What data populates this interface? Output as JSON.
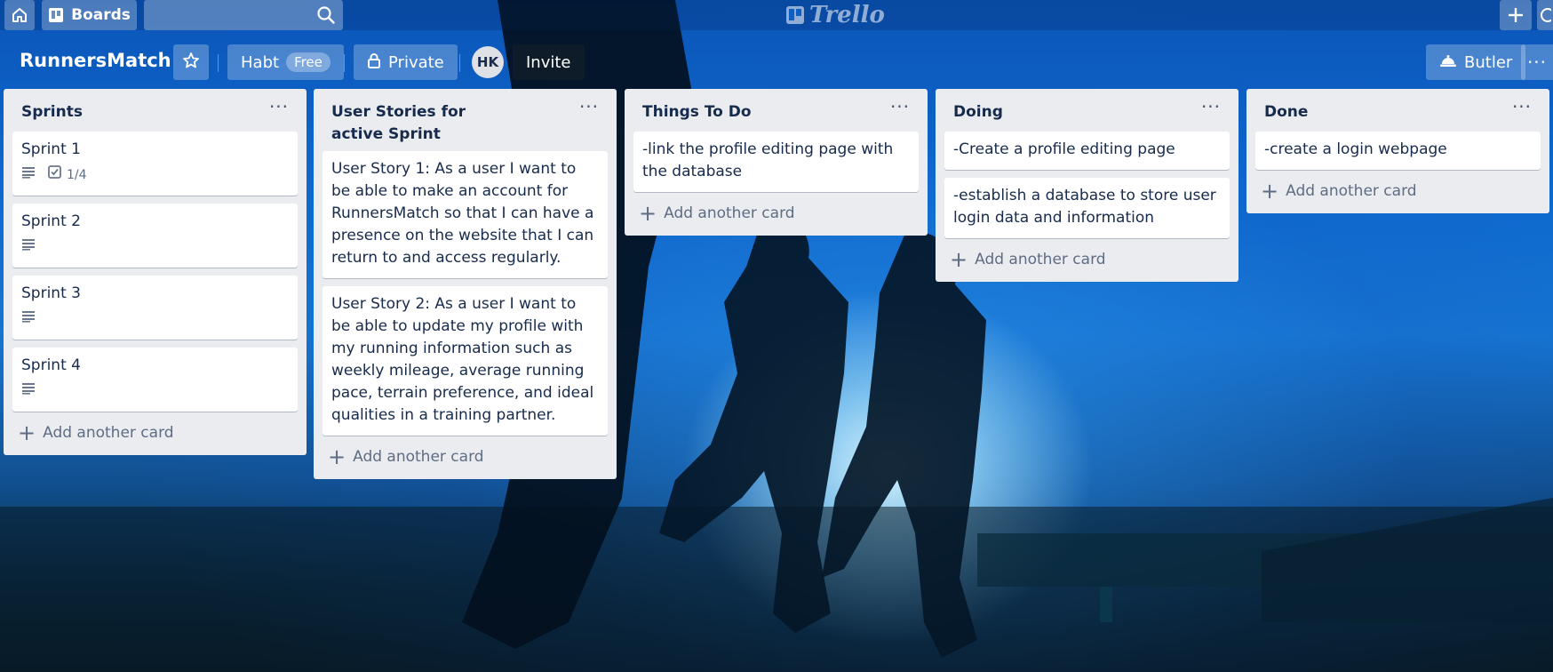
{
  "header": {
    "boards_label": "Boards",
    "search_placeholder": "",
    "logo_text": "Trello"
  },
  "board": {
    "title": "RunnersMatch",
    "team_name": "Habt",
    "team_badge": "Free",
    "visibility": "Private",
    "member_initials": "HK",
    "invite_label": "Invite",
    "butler_label": "Butler"
  },
  "lists": [
    {
      "title": "Sprints",
      "cards": [
        {
          "text": "Sprint 1",
          "checklist": "1/4"
        },
        {
          "text": "Sprint 2"
        },
        {
          "text": "Sprint 3"
        },
        {
          "text": "Sprint 4"
        }
      ],
      "add_label": "Add another card"
    },
    {
      "title": "User Stories for active Sprint",
      "cards": [
        {
          "text": "User Story 1: As a user I want to be able to make an account for RunnersMatch so that I can have a presence on the website that I can return to and access regularly."
        },
        {
          "text": "User Story 2: As a user I want to be able to update my profile with my running information such as weekly mileage, average running pace, terrain preference, and ideal qualities in a training partner."
        }
      ],
      "add_label": "Add another card"
    },
    {
      "title": "Things To Do",
      "cards": [
        {
          "text": "-link the profile editing page with the database"
        }
      ],
      "add_label": "Add another card"
    },
    {
      "title": "Doing",
      "cards": [
        {
          "text": "-Create a profile editing page"
        },
        {
          "text": "-establish a database to store user login data and information"
        }
      ],
      "add_label": "Add another card"
    },
    {
      "title": "Done",
      "cards": [
        {
          "text": "-create a login webpage"
        }
      ],
      "add_label": "Add another card"
    }
  ],
  "colors": {
    "list_bg": "#ebecf0",
    "card_bg": "#ffffff",
    "text_primary": "#172b4d",
    "text_muted": "#5e6c84"
  },
  "icons": {
    "home": "home-icon",
    "boards": "boards-icon",
    "search": "search-icon",
    "add": "plus-icon",
    "star": "star-icon",
    "lock": "lock-icon",
    "butler": "butler-bell-icon",
    "menu": "more-icon",
    "description": "description-icon",
    "checklist": "checklist-icon"
  }
}
